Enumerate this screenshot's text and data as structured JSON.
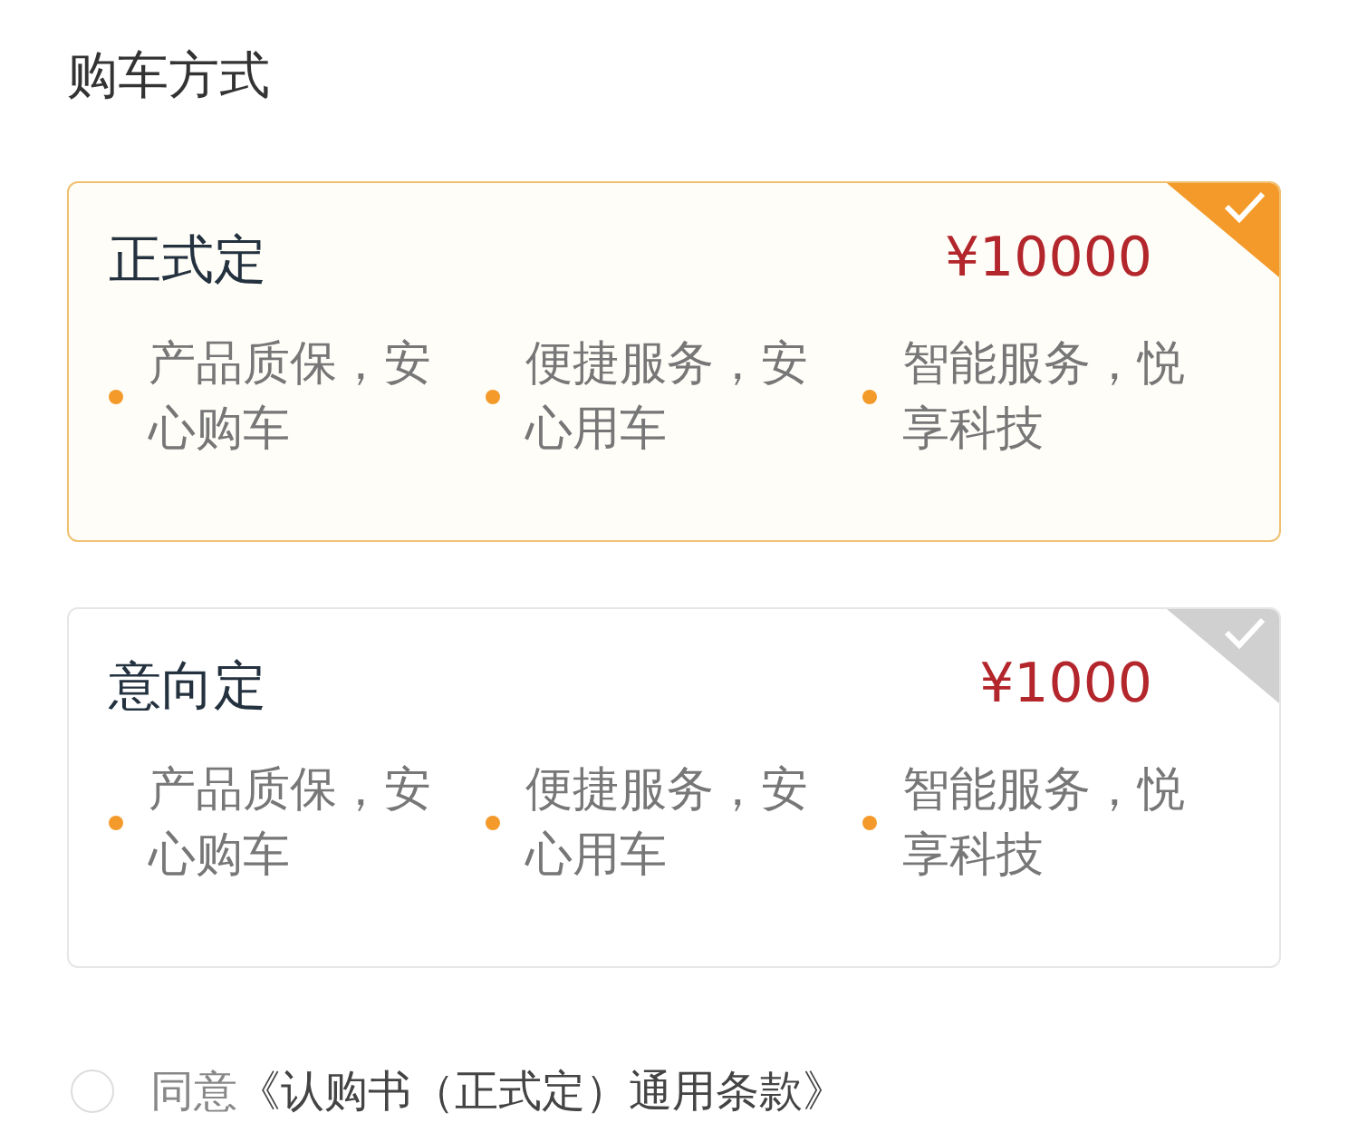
{
  "title": "购车方式",
  "options": [
    {
      "name": "正式定",
      "price": "¥10000",
      "selected": true,
      "features": [
        "产品质保，安心购车",
        "便捷服务，安心用车",
        "智能服务，悦享科技"
      ]
    },
    {
      "name": "意向定",
      "price": "¥1000",
      "selected": false,
      "features": [
        "产品质保，安心购车",
        "便捷服务，安心用车",
        "智能服务，悦享科技"
      ]
    }
  ],
  "agreement": {
    "checked": false,
    "label": "同意",
    "link": "《认购书（正式定）通用条款》"
  }
}
